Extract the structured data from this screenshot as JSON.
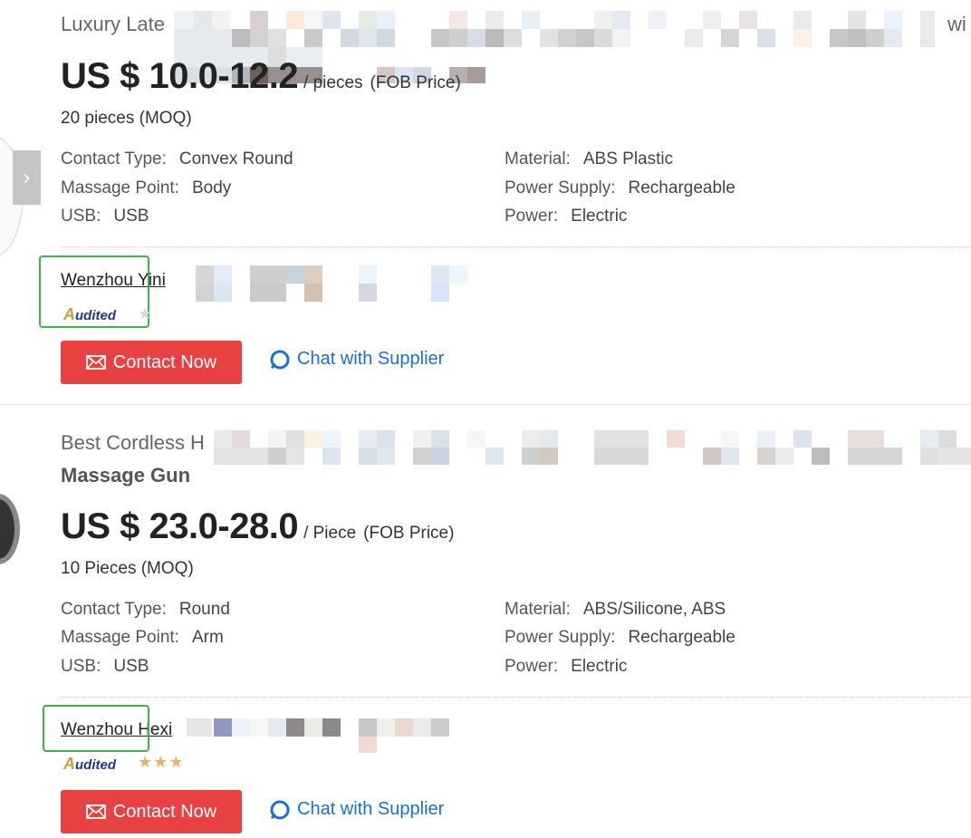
{
  "carousel": {
    "next_icon": "chevron-right-icon",
    "next_glyph": "›"
  },
  "products": [
    {
      "title_prefix": "Luxury Late",
      "title_suffix": "wi",
      "price": "US $ 10.0-12.2",
      "unit": "/ pieces",
      "price_type": "(FOB Price)",
      "moq": "20 pieces",
      "moq_label": "(MOQ)",
      "attributes_left": [
        {
          "label": "Contact Type:",
          "value": "Convex Round"
        },
        {
          "label": "Massage Point:",
          "value": "Body"
        },
        {
          "label": "USB:",
          "value": "USB"
        }
      ],
      "attributes_right": [
        {
          "label": "Material:",
          "value": "ABS Plastic"
        },
        {
          "label": "Power Supply:",
          "value": "Rechargeable"
        },
        {
          "label": "Power:",
          "value": "Electric"
        }
      ],
      "supplier": "Wenzhou Yini",
      "audited_label": "udited",
      "audited_prefix": "A",
      "stars_on": "",
      "stars_off": "★",
      "contact_label": "Contact Now",
      "chat_label": "Chat with Supplier"
    },
    {
      "title_prefix": "Best Cordless H",
      "title_line2": "Massage Gun",
      "price": "US $ 23.0-28.0",
      "unit": "/ Piece",
      "price_type": "(FOB Price)",
      "moq": "10 Pieces",
      "moq_label": "(MOQ)",
      "attributes_left": [
        {
          "label": "Contact Type:",
          "value": "Round"
        },
        {
          "label": "Massage Point:",
          "value": "Arm"
        },
        {
          "label": "USB:",
          "value": "USB"
        }
      ],
      "attributes_right": [
        {
          "label": "Material:",
          "value": "ABS/Silicone, ABS"
        },
        {
          "label": "Power Supply:",
          "value": "Rechargeable"
        },
        {
          "label": "Power:",
          "value": "Electric"
        }
      ],
      "supplier": "Wenzhou Hexi",
      "audited_label": "udited",
      "audited_prefix": "A",
      "stars_on": "★★★",
      "stars_off": "",
      "contact_label": "Contact Now",
      "chat_label": "Chat with Supplier"
    }
  ],
  "colors": {
    "contact_button": "#e84141",
    "chat_link": "#1a6fd6",
    "highlight_box": "#3bb54a",
    "audited_text": "#1b3a8c"
  }
}
